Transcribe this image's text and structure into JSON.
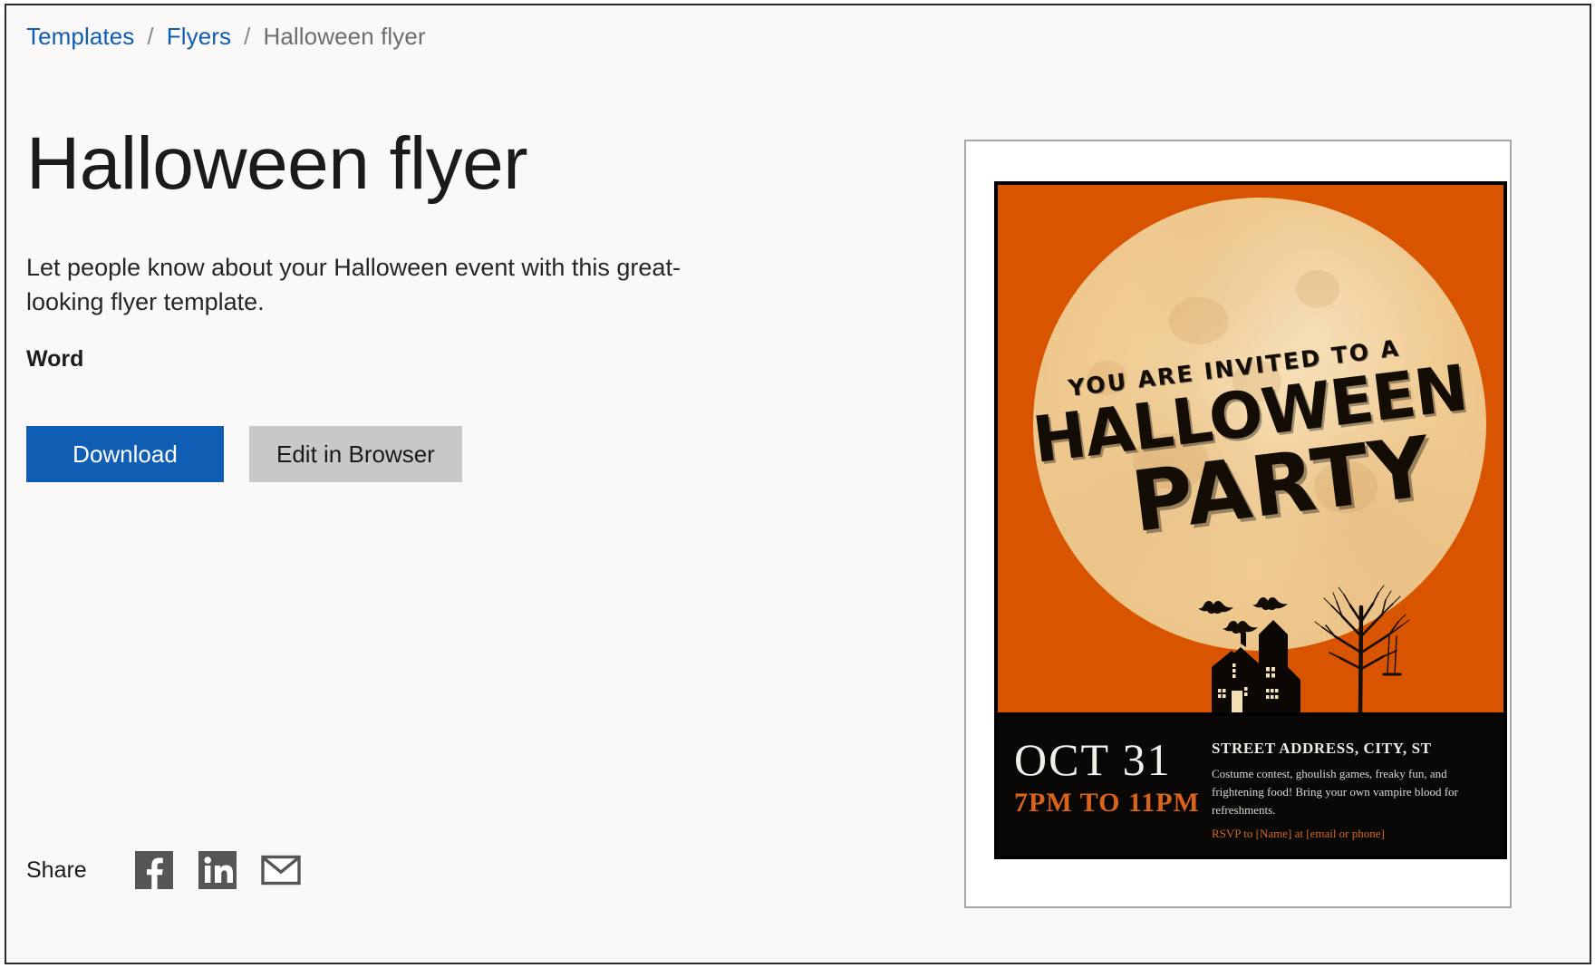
{
  "breadcrumb": {
    "items": [
      {
        "label": "Templates",
        "type": "link"
      },
      {
        "label": "Flyers",
        "type": "link"
      },
      {
        "label": "Halloween flyer",
        "type": "current"
      }
    ],
    "separator": "/"
  },
  "main": {
    "title": "Halloween flyer",
    "description": "Let people know about your Halloween event with this great-looking flyer template.",
    "format_label": "Word"
  },
  "actions": {
    "download_label": "Download",
    "edit_label": "Edit in Browser"
  },
  "share": {
    "label": "Share",
    "icons": [
      {
        "name": "facebook-icon",
        "title": "Facebook"
      },
      {
        "name": "linkedin-icon",
        "title": "LinkedIn"
      },
      {
        "name": "email-icon",
        "title": "Email"
      }
    ]
  },
  "preview": {
    "alt": "Halloween flyer template preview",
    "flyer": {
      "invite_line": "YOU ARE INVITED TO A",
      "headline_1": "HALLOWEEN",
      "headline_2": "PARTY",
      "date": "OCT 31",
      "time": "7PM TO 11PM",
      "address": "STREET ADDRESS, CITY, ST",
      "body": "Costume contest, ghoulish games, freaky fun, and frightening food! Bring your own vampire blood for refreshments.",
      "rsvp": "RSVP to [Name] at [email or phone]"
    }
  },
  "colors": {
    "page_background": "#faf9f8",
    "link_blue": "#0f5eb4",
    "primary_button": "#0f5eb4",
    "secondary_button": "#c8c8c8",
    "breadcrumb_current": "#6e6e6e",
    "flyer_orange": "#d95400",
    "flyer_moon": "#efc98f",
    "flyer_band": "#090806",
    "flyer_time_orange": "#d9631a",
    "share_icon": "#555555"
  }
}
